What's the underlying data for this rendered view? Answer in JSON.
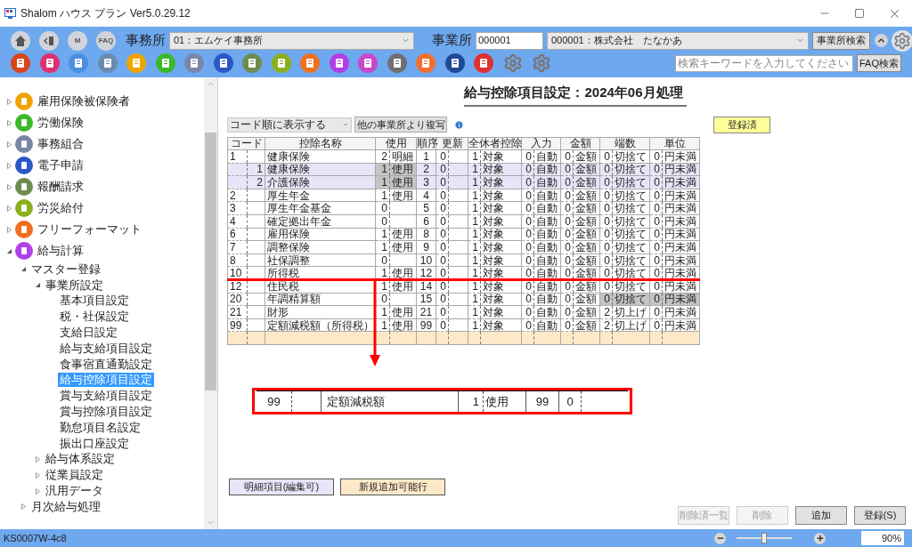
{
  "window": {
    "title": "Shalom ハウス プラン Ver5.0.29.12"
  },
  "header": {
    "nav_buttons": [
      {
        "kind": "home"
      },
      {
        "kind": "back"
      },
      {
        "kind": "text",
        "label": "M"
      },
      {
        "kind": "text",
        "label": "FAQ"
      }
    ],
    "office_label": "事務所",
    "office_value": "01：エムケイ事務所",
    "business_label": "事業所",
    "business_code": "000001",
    "business_value": "000001：株式会社　たなかあ",
    "business_search_button": "事業所検索",
    "app_icons": [
      {
        "kind": "app",
        "color": "#d9441b"
      },
      {
        "kind": "app",
        "color": "#e0306e"
      },
      {
        "kind": "app",
        "color": "#4a8fe0"
      },
      {
        "kind": "app",
        "color": "#6b8bb0"
      },
      {
        "kind": "app",
        "color": "#f0a400"
      },
      {
        "kind": "app",
        "color": "#3cb82c"
      },
      {
        "kind": "app",
        "color": "#7a86a8"
      },
      {
        "kind": "app",
        "color": "#2c57c8"
      },
      {
        "kind": "app",
        "color": "#6e8c4e"
      },
      {
        "kind": "app",
        "color": "#8cb01c"
      },
      {
        "kind": "app",
        "color": "#f07020"
      },
      {
        "kind": "app",
        "color": "#b040e8"
      },
      {
        "kind": "app",
        "color": "#c848c8"
      },
      {
        "kind": "app",
        "color": "#707070"
      },
      {
        "kind": "app",
        "color": "#f07030"
      },
      {
        "kind": "app",
        "color": "#1f4a9a"
      },
      {
        "kind": "app",
        "color": "#e03030"
      },
      {
        "kind": "gear"
      },
      {
        "kind": "gear"
      }
    ],
    "search": {
      "placeholder": "検索キーワードを入力してください"
    },
    "faq_button": "FAQ検索"
  },
  "sidebar": {
    "items": [
      {
        "label": "雇用保険被保険者",
        "color": "#f0a400",
        "expanded": false,
        "selected": false
      },
      {
        "label": "労働保険",
        "color": "#3cb82c",
        "expanded": false,
        "selected": false
      },
      {
        "label": "事務組合",
        "color": "#7a86a8",
        "expanded": false,
        "selected": false
      },
      {
        "label": "電子申請",
        "color": "#2c57c8",
        "expanded": false,
        "selected": false
      },
      {
        "label": "報酬請求",
        "color": "#6e8c4e",
        "expanded": false,
        "selected": false
      },
      {
        "label": "労災給付",
        "color": "#8cb01c",
        "expanded": false,
        "selected": false
      },
      {
        "label": "フリーフォーマット",
        "color": "#f07020",
        "expanded": false,
        "selected": false
      },
      {
        "label": "給与計算",
        "color": "#b040e8",
        "expanded": true,
        "selected": false,
        "children": [
          {
            "label": "マスター登録",
            "expanded": true,
            "selected": false,
            "children": [
              {
                "label": "事業所設定",
                "expanded": true,
                "selected": false,
                "children": [
                  {
                    "label": "基本項目設定",
                    "selected": false
                  },
                  {
                    "label": "税・社保設定",
                    "selected": false
                  },
                  {
                    "label": "支給日設定",
                    "selected": false
                  },
                  {
                    "label": "給与支給項目設定",
                    "selected": false
                  },
                  {
                    "label": "食事宿直通勤設定",
                    "selected": false
                  },
                  {
                    "label": "給与控除項目設定",
                    "selected": true
                  },
                  {
                    "label": "賞与支給項目設定",
                    "selected": false
                  },
                  {
                    "label": "賞与控除項目設定",
                    "selected": false
                  },
                  {
                    "label": "勤怠項目名設定",
                    "selected": false
                  },
                  {
                    "label": "振出口座設定",
                    "selected": false
                  }
                ]
              },
              {
                "label": "給与体系設定",
                "expanded": false,
                "selected": false
              },
              {
                "label": "従業員設定",
                "expanded": false,
                "selected": false
              },
              {
                "label": "汎用データ",
                "expanded": false,
                "selected": false
              }
            ]
          },
          {
            "label": "月次給与処理",
            "expanded": false,
            "selected": false
          }
        ]
      }
    ]
  },
  "page": {
    "title": "給与控除項目設定：2024年06月処理",
    "sort_select": "コード順に表示する",
    "copy_button": "他の事業所より複写",
    "status_badge": "登録済",
    "table": {
      "columns": [
        "コード",
        "控除名称",
        "使用",
        "順序",
        "更新",
        "全休者控除",
        "入力",
        "金額",
        "端数",
        "単位"
      ],
      "rows": [
        {
          "kind": "normal",
          "code": "1",
          "name": "健康保険",
          "use_num": "2",
          "use_label": "明細",
          "order": "1",
          "update": "0",
          "exempt_num": "1",
          "exempt_label": "対象",
          "input_num": "0",
          "input_label": "自動",
          "amount_num": "0",
          "amount_label": "金額",
          "round_num": "0",
          "round_label": "切捨て",
          "unit_num": "0",
          "unit_label": "円未満",
          "use_shaded": false,
          "round_shaded": false,
          "underlined": false
        },
        {
          "kind": "detail",
          "sub": "1",
          "name": "健康保険",
          "use_num": "1",
          "use_label": "使用",
          "order": "2",
          "update": "0",
          "exempt_num": "1",
          "exempt_label": "対象",
          "input_num": "0",
          "input_label": "自動",
          "amount_num": "0",
          "amount_label": "金額",
          "round_num": "0",
          "round_label": "切捨て",
          "unit_num": "0",
          "unit_label": "円未満",
          "use_shaded": true,
          "round_shaded": false,
          "underlined": false
        },
        {
          "kind": "detail",
          "sub": "2",
          "name": "介護保険",
          "use_num": "1",
          "use_label": "使用",
          "order": "3",
          "update": "0",
          "exempt_num": "1",
          "exempt_label": "対象",
          "input_num": "0",
          "input_label": "自動",
          "amount_num": "0",
          "amount_label": "金額",
          "round_num": "0",
          "round_label": "切捨て",
          "unit_num": "0",
          "unit_label": "円未満",
          "use_shaded": true,
          "round_shaded": false,
          "underlined": false
        },
        {
          "kind": "normal",
          "code": "2",
          "name": "厚生年金",
          "use_num": "1",
          "use_label": "使用",
          "order": "4",
          "update": "0",
          "exempt_num": "1",
          "exempt_label": "対象",
          "input_num": "0",
          "input_label": "自動",
          "amount_num": "0",
          "amount_label": "金額",
          "round_num": "0",
          "round_label": "切捨て",
          "unit_num": "0",
          "unit_label": "円未満",
          "use_shaded": false,
          "round_shaded": false,
          "underlined": false
        },
        {
          "kind": "normal",
          "code": "3",
          "name": "厚生年金基金",
          "use_num": "0",
          "order": "5",
          "update": "0",
          "exempt_num": "1",
          "exempt_label": "対象",
          "input_num": "0",
          "input_label": "自動",
          "amount_num": "0",
          "amount_label": "金額",
          "round_num": "0",
          "round_label": "切捨て",
          "unit_num": "0",
          "unit_label": "円未満",
          "use_shaded": false,
          "round_shaded": false,
          "underlined": false
        },
        {
          "kind": "normal",
          "code": "4",
          "name": "確定拠出年金",
          "use_num": "0",
          "order": "6",
          "update": "0",
          "exempt_num": "1",
          "exempt_label": "対象",
          "input_num": "0",
          "input_label": "自動",
          "amount_num": "0",
          "amount_label": "金額",
          "round_num": "0",
          "round_label": "切捨て",
          "unit_num": "0",
          "unit_label": "円未満",
          "use_shaded": false,
          "round_shaded": false,
          "underlined": false
        },
        {
          "kind": "normal",
          "code": "6",
          "name": "雇用保険",
          "use_num": "1",
          "use_label": "使用",
          "order": "8",
          "update": "0",
          "exempt_num": "1",
          "exempt_label": "対象",
          "input_num": "0",
          "input_label": "自動",
          "amount_num": "0",
          "amount_label": "金額",
          "round_num": "0",
          "round_label": "切捨て",
          "unit_num": "0",
          "unit_label": "円未満",
          "use_shaded": false,
          "round_shaded": false,
          "underlined": false
        },
        {
          "kind": "normal",
          "code": "7",
          "name": "調整保険",
          "use_num": "1",
          "use_label": "使用",
          "order": "9",
          "update": "0",
          "exempt_num": "1",
          "exempt_label": "対象",
          "input_num": "0",
          "input_label": "自動",
          "amount_num": "0",
          "amount_label": "金額",
          "round_num": "0",
          "round_label": "切捨て",
          "unit_num": "0",
          "unit_label": "円未満",
          "use_shaded": false,
          "round_shaded": false,
          "underlined": false
        },
        {
          "kind": "normal",
          "code": "8",
          "name": "社保調整",
          "use_num": "0",
          "order": "10",
          "update": "0",
          "exempt_num": "1",
          "exempt_label": "対象",
          "input_num": "0",
          "input_label": "自動",
          "amount_num": "0",
          "amount_label": "金額",
          "round_num": "0",
          "round_label": "切捨て",
          "unit_num": "0",
          "unit_label": "円未満",
          "use_shaded": false,
          "round_shaded": false,
          "underlined": false
        },
        {
          "kind": "normal",
          "code": "10",
          "name": "所得税",
          "use_num": "1",
          "use_label": "使用",
          "order": "12",
          "update": "0",
          "exempt_num": "1",
          "exempt_label": "対象",
          "input_num": "0",
          "input_label": "自動",
          "amount_num": "0",
          "amount_label": "金額",
          "round_num": "0",
          "round_label": "切捨て",
          "unit_num": "0",
          "unit_label": "円未満",
          "use_shaded": false,
          "round_shaded": false,
          "underlined": true
        },
        {
          "kind": "normal",
          "code": "12",
          "name": "住民税",
          "use_num": "1",
          "use_label": "使用",
          "order": "14",
          "update": "0",
          "exempt_num": "1",
          "exempt_label": "対象",
          "input_num": "0",
          "input_label": "自動",
          "amount_num": "0",
          "amount_label": "金額",
          "round_num": "0",
          "round_label": "切捨て",
          "unit_num": "0",
          "unit_label": "円未満",
          "use_shaded": false,
          "round_shaded": false,
          "underlined": false
        },
        {
          "kind": "normal",
          "code": "20",
          "name": "年調精算額",
          "use_num": "0",
          "order": "15",
          "update": "0",
          "exempt_num": "1",
          "exempt_label": "対象",
          "input_num": "0",
          "input_label": "自動",
          "amount_num": "0",
          "amount_label": "金額",
          "round_num": "0",
          "round_label": "切捨て",
          "unit_num": "0",
          "unit_label": "円未満",
          "use_shaded": false,
          "round_shaded": true,
          "underlined": false
        },
        {
          "kind": "normal",
          "code": "21",
          "name": "財形",
          "use_num": "1",
          "use_label": "使用",
          "order": "21",
          "update": "0",
          "exempt_num": "1",
          "exempt_label": "対象",
          "input_num": "0",
          "input_label": "自動",
          "amount_num": "0",
          "amount_label": "金額",
          "round_num": "2",
          "round_label": "切上げ",
          "unit_num": "0",
          "unit_label": "円未満",
          "use_shaded": false,
          "round_shaded": false,
          "underlined": false
        },
        {
          "kind": "normal",
          "code": "99",
          "name": "定額減税額（所得税）",
          "use_num": "1",
          "use_label": "使用",
          "order": "99",
          "update": "0",
          "exempt_num": "1",
          "exempt_label": "対象",
          "input_num": "0",
          "input_label": "自動",
          "amount_num": "0",
          "amount_label": "金額",
          "round_num": "2",
          "round_label": "切上げ",
          "unit_num": "0",
          "unit_label": "円未満",
          "use_shaded": false,
          "round_shaded": false,
          "underlined": false
        },
        {
          "kind": "new",
          "use_shaded": false,
          "round_shaded": false,
          "underlined": false
        }
      ]
    },
    "callout": {
      "code": "99",
      "name": "定額減税額",
      "use_num": "1",
      "use_label": "使用",
      "order": "99",
      "update": "0"
    },
    "legend": [
      {
        "kind": "detail",
        "label": "明細項目(編集可)"
      },
      {
        "kind": "new",
        "label": "新規追加可能行"
      }
    ],
    "buttons": [
      {
        "label": "削除済一覧",
        "disabled": true
      },
      {
        "label": "削除",
        "disabled": true
      },
      {
        "label": "追加",
        "disabled": false
      },
      {
        "label": "登録(S)",
        "disabled": false
      }
    ]
  },
  "status_bar": {
    "code": "KS0007W-4c8",
    "zoom": {
      "level": 0.5,
      "reading": "90%"
    }
  }
}
